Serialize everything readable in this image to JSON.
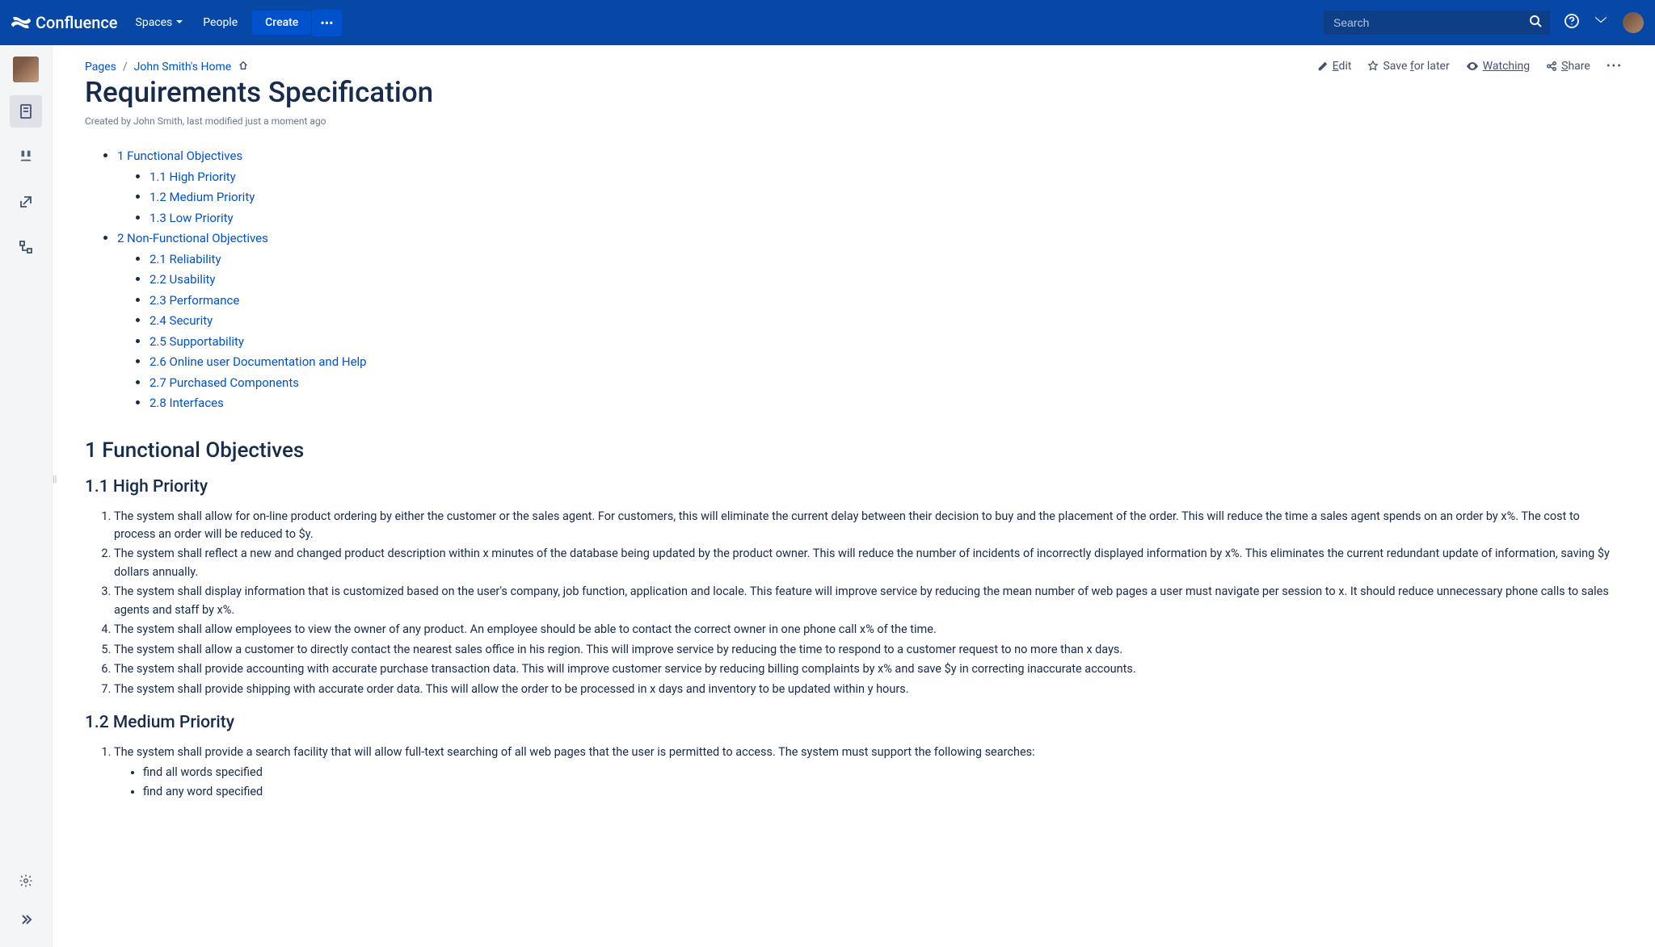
{
  "app": {
    "name": "Confluence"
  },
  "nav": {
    "spaces": "Spaces",
    "people": "People",
    "create": "Create",
    "search_placeholder": "Search"
  },
  "breadcrumb": {
    "pages": "Pages",
    "home": "John Smith's Home"
  },
  "actions": {
    "edit": "Edit",
    "save": "Save for later",
    "watching": "Watching",
    "share": "Share"
  },
  "page": {
    "title": "Requirements Specification",
    "meta": "Created by John Smith, last modified just a moment ago"
  },
  "toc": {
    "s1": "1 Functional Objectives",
    "s1_1": "1.1 High Priority",
    "s1_2": "1.2 Medium Priority",
    "s1_3": "1.3 Low Priority",
    "s2": "2 Non-Functional Objectives",
    "s2_1": "2.1 Reliability",
    "s2_2": "2.2 Usability",
    "s2_3": "2.3 Performance",
    "s2_4": "2.4 Security",
    "s2_5": "2.5 Supportability",
    "s2_6": "2.6 Online user Documentation and Help",
    "s2_7": "2.7 Purchased Components",
    "s2_8": "2.8 Interfaces"
  },
  "body": {
    "h1": "1 Functional Objectives",
    "h1_1": "1.1 High Priority",
    "hp1": "The system shall allow for on-line product ordering by either the customer or the sales agent. For customers, this will eliminate the current delay between their decision to buy and the placement of the order. This will reduce the time a sales agent spends on an order by x%. The cost to process an order will be reduced to $y.",
    "hp2": "The system shall reflect a new and changed product description within x minutes of the database being updated by the product owner. This will reduce the number of incidents of incorrectly displayed information by x%. This eliminates the current redundant update of information, saving $y dollars annually.",
    "hp3": "The system shall display information that is customized based on the user's company, job function, application and locale. This feature will improve service by reducing the mean number of web pages a user must navigate per session to x. It should reduce unnecessary phone calls to sales agents and staff by x%.",
    "hp4": "The system shall allow employees to view the owner of any product. An employee should be able to contact the correct owner in one phone call x% of the time.",
    "hp5": "The system shall allow a customer to directly contact the nearest sales office in his region. This will improve service by reducing the time to respond to a customer request to no more than x days.",
    "hp6": "The system shall provide accounting with accurate purchase transaction data. This will improve customer service by reducing billing complaints by x% and save $y in correcting inaccurate accounts.",
    "hp7": "The system shall provide shipping with accurate order data. This will allow the order to be processed in x days and inventory to be updated within y hours.",
    "h1_2": "1.2 Medium Priority",
    "mp1": "The system shall provide a search facility that will allow full-text searching of all web pages that the user is permitted to access. The system must support the following searches:",
    "mp1_b1": "find all words specified",
    "mp1_b2": "find any word specified"
  }
}
